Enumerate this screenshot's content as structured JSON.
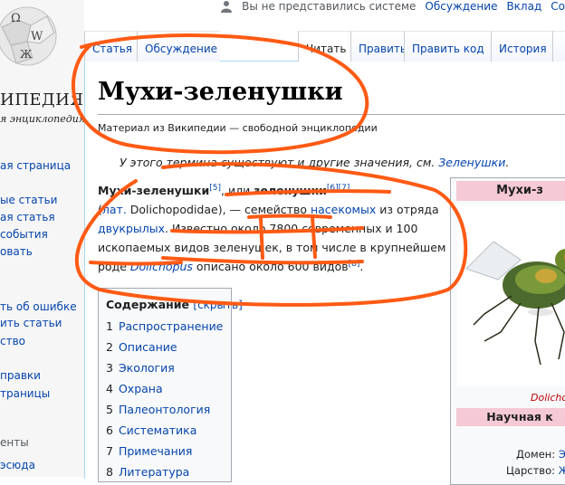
{
  "personal": {
    "not_logged": "Вы не представились системе",
    "talk": "Обсуждение",
    "contributions": "Вклад",
    "create": "Со"
  },
  "logo": {
    "title": "ИПЕДИЯ",
    "subtitle": "я энциклопедия"
  },
  "sidebar": {
    "nav": [
      "ая страница",
      "ые статьи",
      "ая статья",
      "события",
      "овать"
    ],
    "tools": [
      "ть об ошибке",
      "ить статьи",
      "ство"
    ],
    "more": [
      "правки",
      "траницы"
    ],
    "section_heading": "енты",
    "bottom": "эсюда"
  },
  "tabs": {
    "article": "Статья",
    "discussion": "Обсуждение",
    "read": "Читать",
    "edit": "Править",
    "edit_code": "Править код",
    "history": "История"
  },
  "article": {
    "title": "Мухи-зеленушки",
    "tagline": "Материал из Википедии — свободной энциклопедии",
    "hatnote_text": "У этого термина существуют и другие значения, см. ",
    "hatnote_link": "Зеленушки",
    "hatnote_end": ".",
    "p1_bold1": "Мухи-зеленушки",
    "p1_ref1": "[5]",
    "p1_mid": ", или ",
    "p1_bold2": "зеленушки",
    "p1_ref2": "[6][7]",
    "p2_open": "(",
    "p2_lat_link": "лат.",
    "p2_lat": " Dolichopodidae), — семейство ",
    "p2_link": "насекомых",
    "p2_end": " из отряда",
    "p3_link": "двукрылых",
    "p3_text": ". Известно около 7800 современных и 100",
    "p4_text": "ископаемых видов зеленушек, в том числе в крупнейшем",
    "p5_text1": "роде ",
    "p5_link": "Dolichopus",
    "p5_text2": " описано около 600 видов",
    "p5_ref": "[8]",
    "p5_end": "."
  },
  "toc": {
    "title": "Содержание",
    "toggle": "[скрыть]",
    "items": [
      {
        "num": "1",
        "label": "Распространение"
      },
      {
        "num": "2",
        "label": "Описание"
      },
      {
        "num": "3",
        "label": "Экология"
      },
      {
        "num": "4",
        "label": "Охрана"
      },
      {
        "num": "5",
        "label": "Палеонтология"
      },
      {
        "num": "6",
        "label": "Систематика"
      },
      {
        "num": "7",
        "label": "Примечания"
      },
      {
        "num": "8",
        "label": "Литература"
      }
    ]
  },
  "infobox": {
    "title": "Мухи-з",
    "caption": "Dolicho",
    "section": "Научная к",
    "domain_label": "Домен:",
    "domain_value": "Э",
    "kingdom_label": "Царство:",
    "kingdom_value": "Ж"
  },
  "colors": {
    "link": "#0645ad",
    "annotation": "#ff5a14",
    "infobox_header": "#f5c9d5"
  }
}
